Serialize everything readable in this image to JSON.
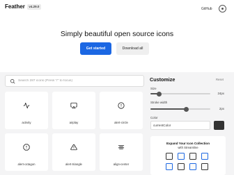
{
  "header": {
    "brand": "Feather",
    "version": "v4.29.0",
    "github_label": "GitHub"
  },
  "hero": {
    "headline": "Simply beautiful open source icons",
    "primary_label": "Get started",
    "secondary_label": "Download all"
  },
  "search": {
    "placeholder": "Search 287 icons (Press \"/\" to focus)"
  },
  "icons": [
    {
      "name": "activity",
      "icon": "activity-icon"
    },
    {
      "name": "airplay",
      "icon": "airplay-icon"
    },
    {
      "name": "alert-circle",
      "icon": "alert-circle-icon"
    },
    {
      "name": "alert-octagon",
      "icon": "alert-octagon-icon"
    },
    {
      "name": "alert-triangle",
      "icon": "alert-triangle-icon"
    },
    {
      "name": "align-center",
      "icon": "align-center-icon"
    }
  ],
  "customize": {
    "title": "Customize",
    "reset_label": "Reset",
    "size_label": "Size",
    "size_value": "24px",
    "size_level": 0.15,
    "stroke_label": "Stroke width",
    "stroke_value": "2px",
    "stroke_level": 0.6,
    "color_label": "Color",
    "color_value": "currentColor",
    "swatch_color": "#333333"
  },
  "promo": {
    "title": "Expand Your Icon Collection",
    "subtitle": "with Streamline"
  },
  "colors": {
    "accent": "#1b67e3",
    "background": "#f4f4f5"
  }
}
